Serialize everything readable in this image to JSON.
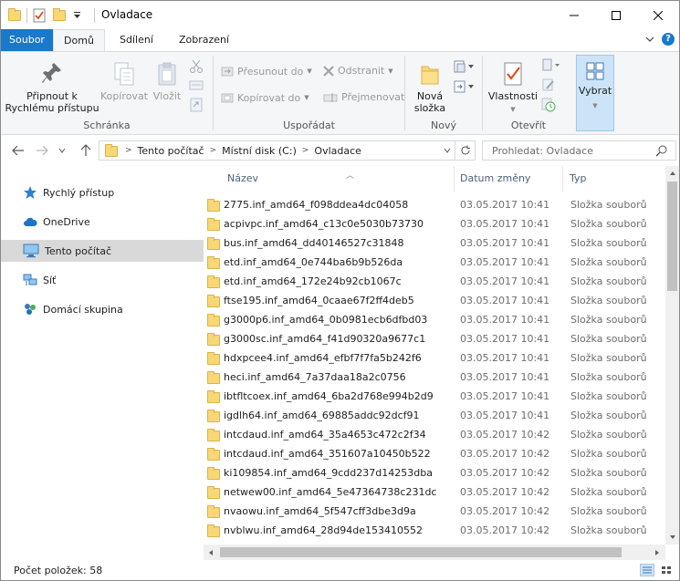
{
  "window": {
    "title": "Ovladace",
    "controls": {
      "minimize": "—",
      "maximize": "☐",
      "close": "✕"
    }
  },
  "tabs": {
    "file": "Soubor",
    "home": "Domů",
    "share": "Sdílení",
    "view": "Zobrazení",
    "collapse": "∨",
    "help": "?"
  },
  "ribbon": {
    "clipboard": {
      "label": "Schránka",
      "pin": "Připnout k Rychlému přístupu",
      "pin_line1": "Připnout k",
      "pin_line2": "Rychlému přístupu",
      "copy": "Kopírovat",
      "paste": "Vložit"
    },
    "organize": {
      "label": "Uspořádat",
      "move_to": "Přesunout do",
      "copy_to": "Kopírovat do",
      "delete": "Odstranit",
      "rename": "Přejmenovat"
    },
    "new": {
      "label": "Nový",
      "new_folder_line1": "Nová",
      "new_folder_line2": "složka"
    },
    "open": {
      "label": "Otevřít",
      "properties": "Vlastnosti"
    },
    "select": {
      "label": "Vybrat"
    }
  },
  "address": {
    "crumbs": [
      "Tento počítač",
      "Místní disk (C:)",
      "Ovladace"
    ],
    "search_placeholder": "Prohledat: Ovladace"
  },
  "nav": {
    "items": [
      {
        "label": "Rychlý přístup",
        "icon": "star-icon"
      },
      {
        "label": "OneDrive",
        "icon": "cloud-icon"
      },
      {
        "label": "Tento počítač",
        "icon": "computer-icon"
      },
      {
        "label": "Síť",
        "icon": "network-icon"
      },
      {
        "label": "Domácí skupina",
        "icon": "homegroup-icon"
      }
    ]
  },
  "columns": {
    "name": "Název",
    "date": "Datum změny",
    "type": "Typ"
  },
  "files": [
    {
      "name": "2775.inf_amd64_f098ddea4dc04058",
      "date": "03.05.2017 10:41",
      "type": "Složka souborů"
    },
    {
      "name": "acpivpc.inf_amd64_c13c0e5030b73730",
      "date": "03.05.2017 10:41",
      "type": "Složka souborů"
    },
    {
      "name": "bus.inf_amd64_dd40146527c31848",
      "date": "03.05.2017 10:41",
      "type": "Složka souborů"
    },
    {
      "name": "etd.inf_amd64_0e744ba6b9b526da",
      "date": "03.05.2017 10:41",
      "type": "Složka souborů"
    },
    {
      "name": "etd.inf_amd64_172e24b92cb1067c",
      "date": "03.05.2017 10:41",
      "type": "Složka souborů"
    },
    {
      "name": "ftse195.inf_amd64_0caae67f2ff4deb5",
      "date": "03.05.2017 10:41",
      "type": "Složka souborů"
    },
    {
      "name": "g3000p6.inf_amd64_0b0981ecb6dfbd03",
      "date": "03.05.2017 10:41",
      "type": "Složka souborů"
    },
    {
      "name": "g3000sc.inf_amd64_f41d90320a9677c1",
      "date": "03.05.2017 10:41",
      "type": "Složka souborů"
    },
    {
      "name": "hdxpcee4.inf_amd64_efbf7f7fa5b242f6",
      "date": "03.05.2017 10:41",
      "type": "Složka souborů"
    },
    {
      "name": "heci.inf_amd64_7a37daa18a2c0756",
      "date": "03.05.2017 10:41",
      "type": "Složka souborů"
    },
    {
      "name": "ibtfltcoex.inf_amd64_6ba2d768e994b2d9",
      "date": "03.05.2017 10:41",
      "type": "Složka souborů"
    },
    {
      "name": "igdlh64.inf_amd64_69885addc92dcf91",
      "date": "03.05.2017 10:41",
      "type": "Složka souborů"
    },
    {
      "name": "intcdaud.inf_amd64_35a4653c472c2f34",
      "date": "03.05.2017 10:42",
      "type": "Složka souborů"
    },
    {
      "name": "intcdaud.inf_amd64_351607a10450b522",
      "date": "03.05.2017 10:42",
      "type": "Složka souborů"
    },
    {
      "name": "ki109854.inf_amd64_9cdd237d14253dba",
      "date": "03.05.2017 10:42",
      "type": "Složka souborů"
    },
    {
      "name": "netwew00.inf_amd64_5e47364738c231dc",
      "date": "03.05.2017 10:42",
      "type": "Složka souborů"
    },
    {
      "name": "nvaowu.inf_amd64_5f547cff3dbe3d9a",
      "date": "03.05.2017 10:42",
      "type": "Složka souborů"
    },
    {
      "name": "nvblwu.inf_amd64_28d94de153410552",
      "date": "03.05.2017 10:42",
      "type": "Složka souborů"
    }
  ],
  "status": {
    "item_count": "Počet položek: 58"
  },
  "colors": {
    "accent": "#1979ca",
    "folder": "#f8d775",
    "selected_nav": "#d9d9d9"
  }
}
